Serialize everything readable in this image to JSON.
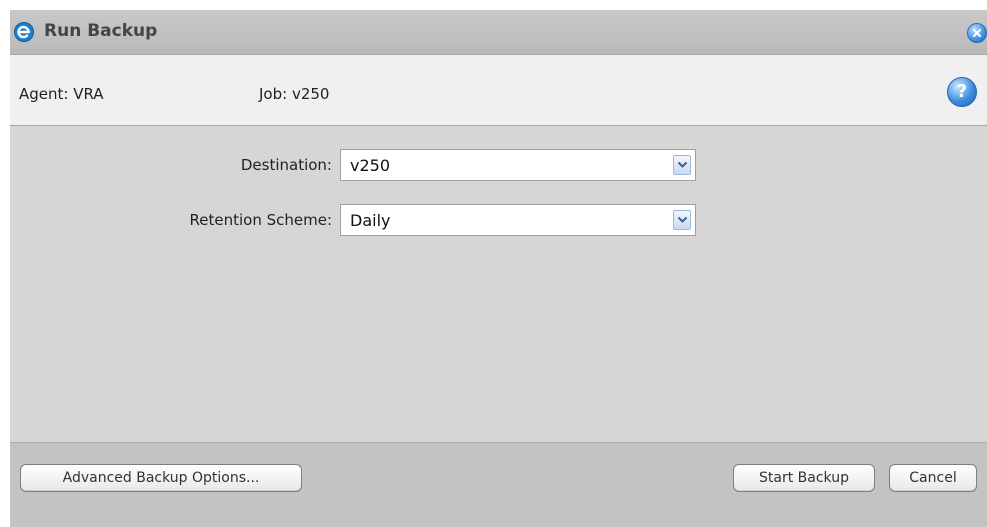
{
  "dialog": {
    "title": "Run Backup",
    "app_icon": "app-logo-icon",
    "close_icon": "close-icon"
  },
  "info": {
    "agent_label": "Agent: VRA",
    "job_label": "Job: v250",
    "help_icon": "help-icon",
    "help_glyph": "?"
  },
  "form": {
    "destination_label": "Destination:",
    "destination_value": "v250",
    "retention_label": "Retention Scheme:",
    "retention_value": "Daily"
  },
  "footer": {
    "advanced_label": "Advanced Backup Options...",
    "start_label": "Start Backup",
    "cancel_label": "Cancel"
  },
  "colors": {
    "accent": "#1f7fc9",
    "dialog_bg": "#d6d6d6",
    "titlebar_bg": "#c3c3c3"
  }
}
